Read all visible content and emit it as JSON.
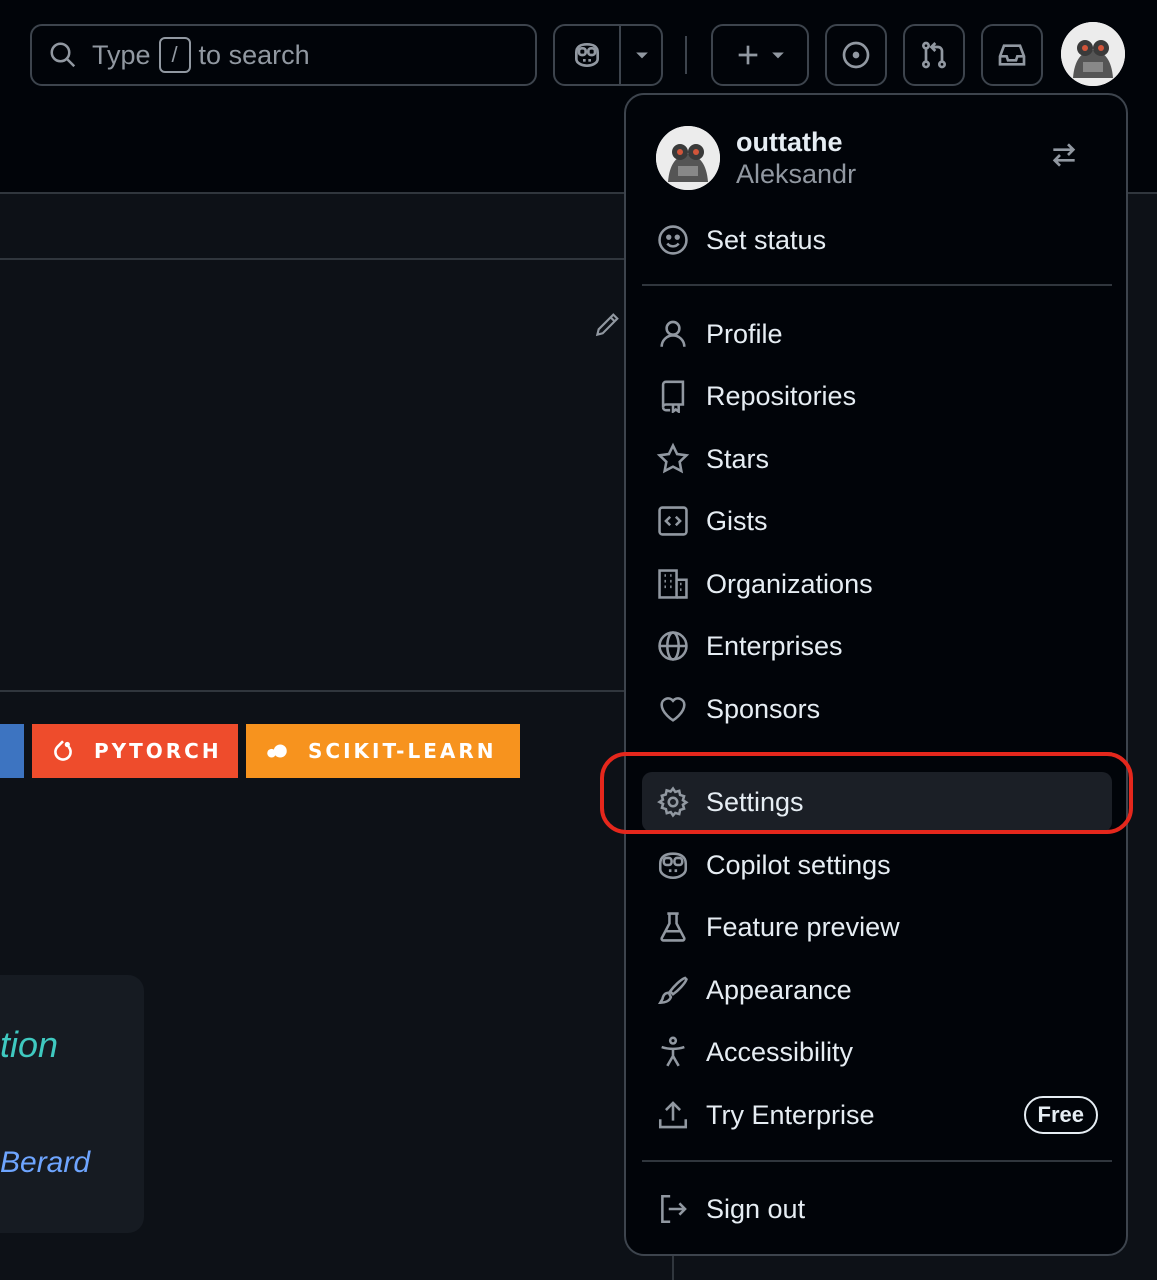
{
  "header": {
    "search": {
      "prefix": "Type",
      "key": "/",
      "suffix": "to search"
    }
  },
  "menu": {
    "user": {
      "login": "outtathe",
      "name": "Aleksandr"
    },
    "set_status": "Set status",
    "items": [
      {
        "label": "Profile",
        "icon": "person-icon"
      },
      {
        "label": "Repositories",
        "icon": "repo-icon"
      },
      {
        "label": "Stars",
        "icon": "star-icon"
      },
      {
        "label": "Gists",
        "icon": "code-square-icon"
      },
      {
        "label": "Organizations",
        "icon": "organization-icon"
      },
      {
        "label": "Enterprises",
        "icon": "globe-icon"
      },
      {
        "label": "Sponsors",
        "icon": "heart-icon"
      },
      {
        "label": "Settings",
        "icon": "gear-icon"
      },
      {
        "label": "Copilot settings",
        "icon": "copilot-icon"
      },
      {
        "label": "Feature preview",
        "icon": "beaker-icon"
      },
      {
        "label": "Appearance",
        "icon": "paintbrush-icon"
      },
      {
        "label": "Accessibility",
        "icon": "accessibility-icon"
      },
      {
        "label": "Try Enterprise",
        "icon": "upload-icon",
        "badge": "Free"
      },
      {
        "label": "Sign out",
        "icon": "sign-out-icon"
      }
    ]
  },
  "background": {
    "badges": [
      {
        "label": "PYTORCH",
        "color": "#ee4c2c"
      },
      {
        "label": "SCIKIT-LEARN",
        "color": "#f7931e"
      }
    ],
    "card_text_1": "tion",
    "card_text_2": "Berard"
  },
  "colors": {
    "highlight": "#e5271c",
    "accent_text": "#e6edf3",
    "muted": "#9198a1"
  }
}
